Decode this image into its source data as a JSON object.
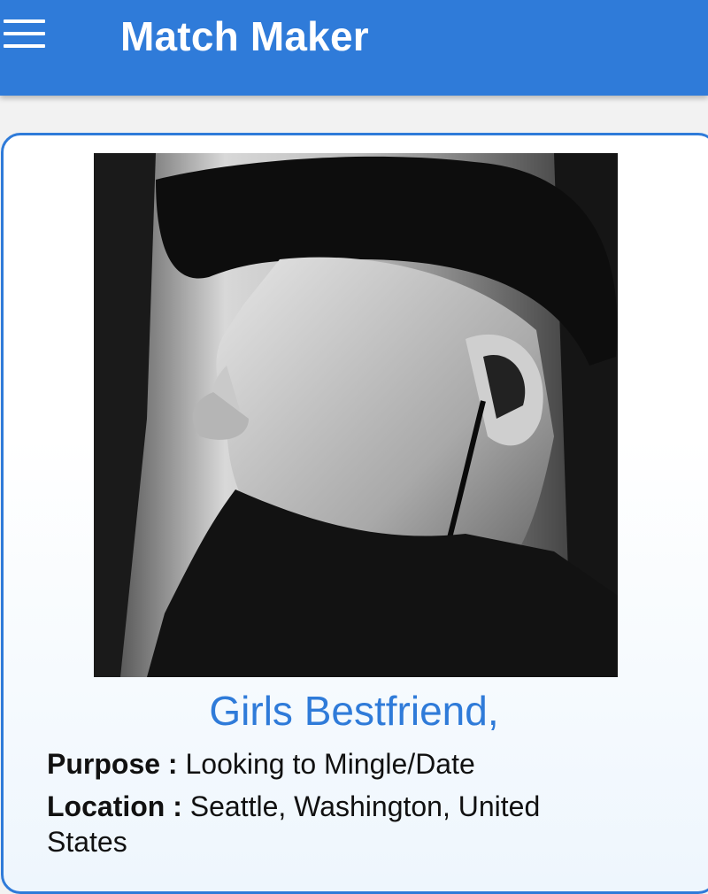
{
  "app_bar": {
    "title": "Match Maker",
    "menu_icon": "hamburger-menu-icon",
    "color": "#2f7bd9"
  },
  "profile": {
    "name": "Girls Bestfriend,",
    "photo_description": "black-and-white photo of a man in a baseball cap and earbuds, sticking out his tongue",
    "purpose_label": "Purpose :",
    "purpose_value": "Looking to Mingle/Date",
    "location_label": "Location :",
    "location_value": "Seattle, Washington, United States"
  },
  "colors": {
    "accent": "#2f7bd9",
    "text": "#111111"
  }
}
